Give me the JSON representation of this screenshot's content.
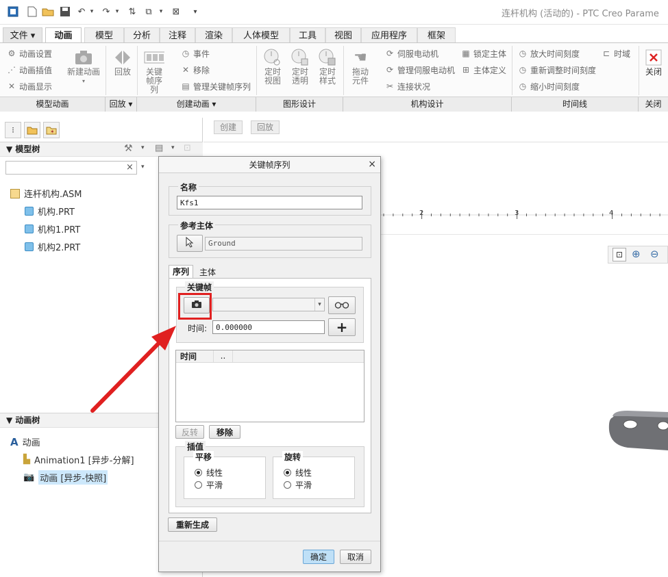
{
  "app": {
    "window_title": "连杆机构 (活动的) - PTC Creo Parame"
  },
  "tabs": [
    {
      "label": "文件"
    },
    {
      "label": "动画"
    },
    {
      "label": "模型"
    },
    {
      "label": "分析"
    },
    {
      "label": "注释"
    },
    {
      "label": "渲染"
    },
    {
      "label": "人体模型"
    },
    {
      "label": "工具"
    },
    {
      "label": "视图"
    },
    {
      "label": "应用程序"
    },
    {
      "label": "框架"
    }
  ],
  "ribbon": {
    "model_anim": {
      "settings": "动画设置",
      "interp": "动画插值",
      "display": "动画显示",
      "new_anim": "新建动画",
      "group": "模型动画"
    },
    "playback": {
      "replay": "回放",
      "group": "回放"
    },
    "create": {
      "keyframe_seq": "关键帧序列",
      "event": "事件",
      "remove": "移除",
      "manage_kfs": "管理关键帧序列",
      "group": "创建动画"
    },
    "graphics": {
      "timed_view": "定时视图",
      "timed_trans": "定时透明",
      "timed_style": "定时样式",
      "group": "图形设计"
    },
    "mech": {
      "drag": "拖动元件",
      "servo": "伺服电动机",
      "manage_servo": "管理伺服电动机",
      "connect": "连接状况",
      "lock_body": "锁定主体",
      "body_def": "主体定义",
      "group": "机构设计"
    },
    "timeline": {
      "zoom_in": "放大时间刻度",
      "readjust": "重新调整时间刻度",
      "zoom_out": "缩小时间刻度",
      "time_domain": "时域",
      "group": "时间线"
    },
    "close": {
      "label": "关闭",
      "group": "关闭"
    }
  },
  "sub_toolbar": {
    "create": "创建",
    "replay": "回放"
  },
  "model_tree": {
    "header": "模型树",
    "search_value": "",
    "items": [
      {
        "label": "连杆机构.ASM"
      },
      {
        "label": "机构.PRT"
      },
      {
        "label": "机构1.PRT"
      },
      {
        "label": "机构2.PRT"
      }
    ]
  },
  "anim_tree": {
    "header": "动画树",
    "items": [
      {
        "label": "动画"
      },
      {
        "label": "Animation1 [异步-分解]"
      },
      {
        "label": "动画 [异步-快照]"
      }
    ]
  },
  "timeline_ruler": {
    "ticks": [
      "2",
      "3",
      "4"
    ]
  },
  "dialog": {
    "title": "关键帧序列",
    "name_section": "名称",
    "name_value": "Kfs1",
    "ref_section": "参考主体",
    "ref_value": "Ground",
    "tabs": [
      {
        "label": "序列"
      },
      {
        "label": "主体"
      }
    ],
    "keyframe_section": "关键帧",
    "time_label": "时间:",
    "time_value": "0.000000",
    "table_headers": [
      "时间",
      ".."
    ],
    "reverse_btn": "反转",
    "remove_btn": "移除",
    "interp_section": "插值",
    "translation": {
      "title": "平移",
      "linear": "线性",
      "smooth": "平滑"
    },
    "rotation": {
      "title": "旋转",
      "linear": "线性",
      "smooth": "平滑"
    },
    "regenerate_btn": "重新生成",
    "ok_btn": "确定",
    "cancel_btn": "取消"
  },
  "colors": {
    "annotation_red": "#e02020",
    "selected_bg": "#cde8fb",
    "ok_bg": "#bfe0f7"
  }
}
